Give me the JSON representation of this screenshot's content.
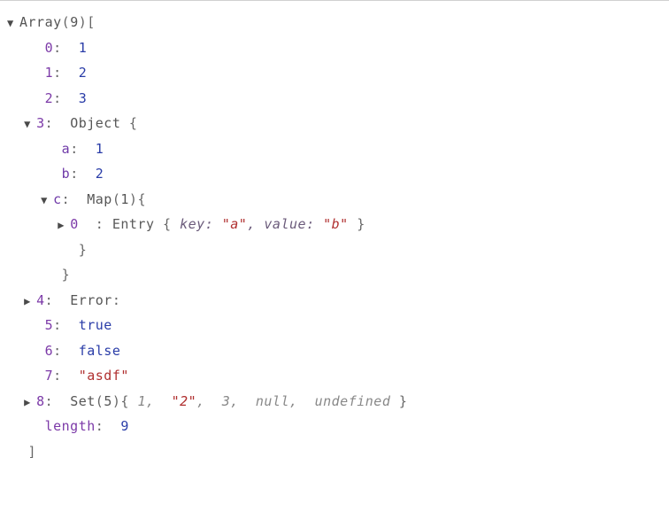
{
  "root": {
    "label": "Array",
    "count": "9",
    "open": "[",
    "close": "]",
    "lengthKey": "length",
    "lengthValue": "9"
  },
  "items": {
    "i0": {
      "idx": "0",
      "val": "1"
    },
    "i1": {
      "idx": "1",
      "val": "2"
    },
    "i2": {
      "idx": "2",
      "val": "3"
    },
    "i3": {
      "idx": "3",
      "type": "Object",
      "open": "{",
      "close": "}",
      "a": {
        "key": "a",
        "val": "1"
      },
      "b": {
        "key": "b",
        "val": "2"
      },
      "c": {
        "key": "c",
        "type": "Map",
        "count": "1",
        "open": "{",
        "close": "}",
        "entry0": {
          "idx": "0",
          "label": "Entry",
          "open": "{",
          "close": "}",
          "keyLabel": "key",
          "keyVal": "\"a\"",
          "valLabel": "value",
          "valVal": "\"b\""
        }
      }
    },
    "i4": {
      "idx": "4",
      "type": "Error",
      "suffix": ":"
    },
    "i5": {
      "idx": "5",
      "val": "true"
    },
    "i6": {
      "idx": "6",
      "val": "false"
    },
    "i7": {
      "idx": "7",
      "val": "\"asdf\""
    },
    "i8": {
      "idx": "8",
      "type": "Set",
      "count": "5",
      "open": "{",
      "close": "}",
      "preview": {
        "p0": "1",
        "p1": "\"2\"",
        "p2": "3",
        "p3": "null",
        "p4": "undefined"
      }
    }
  },
  "sep": ", "
}
